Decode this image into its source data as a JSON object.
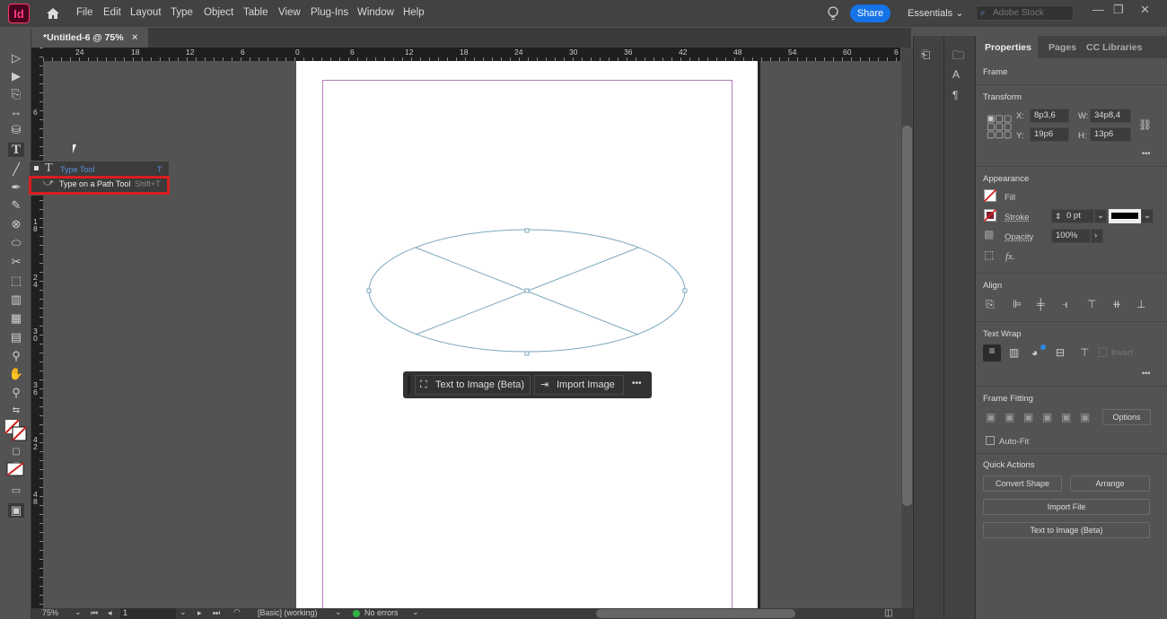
{
  "app": {
    "logo": "Id",
    "menu": [
      "File",
      "Edit",
      "Layout",
      "Type",
      "Object",
      "Table",
      "View",
      "Plug-Ins",
      "Window",
      "Help"
    ],
    "share_label": "Share",
    "workspace": "Essentials",
    "search_placeholder": "Adobe Stock",
    "accent": "#1473e6"
  },
  "document": {
    "tab_title": "*Untitled-6 @ 75%",
    "close_glyph": "×"
  },
  "rulers": {
    "horizontal": [
      "24",
      "18",
      "12",
      "6",
      "0",
      "6",
      "12",
      "18",
      "24",
      "30",
      "36",
      "42",
      "48",
      "54",
      "60",
      "6"
    ],
    "vertical": [
      "6",
      "1 8",
      "2 4",
      "3 0",
      "3 6",
      "4 2",
      "4 8"
    ]
  },
  "flyout": {
    "items": [
      {
        "label": "Type Tool",
        "shortcut": "T",
        "active": true
      },
      {
        "label": "Type on a Path Tool",
        "shortcut": "Shift+T",
        "highlighted": true
      }
    ],
    "highlight_color": "#d81e1e"
  },
  "context_bar": {
    "text_to_image": "Text to Image (Beta)",
    "import_image": "Import Image",
    "more": "•••"
  },
  "status": {
    "zoom": "75%",
    "page": "1",
    "preflight_profile": "[Basic] (working)",
    "errors": "No errors",
    "ok_color": "#2fb344"
  },
  "properties": {
    "tabs": [
      "Properties",
      "Pages",
      "CC Libraries"
    ],
    "object_type": "Frame",
    "transform": {
      "title": "Transform",
      "x_label": "X:",
      "x": "8p3,6",
      "y_label": "Y:",
      "y": "19p6",
      "w_label": "W:",
      "w": "34p8,4",
      "h_label": "H:",
      "h": "13p6"
    },
    "appearance": {
      "title": "Appearance",
      "fill": "Fill",
      "stroke": "Stroke",
      "stroke_weight": "0 pt",
      "opacity_label": "Opacity",
      "opacity": "100%",
      "fx": "fx."
    },
    "align_title": "Align",
    "text_wrap": {
      "title": "Text Wrap",
      "invert": "Invert"
    },
    "frame_fitting": {
      "title": "Frame Fitting",
      "options": "Options",
      "auto_fit": "Auto-Fit"
    },
    "quick_actions": {
      "title": "Quick Actions",
      "convert_shape": "Convert Shape",
      "arrange": "Arrange",
      "import_file": "Import File",
      "text_to_image": "Text to Image (Beta)"
    },
    "more": "•••"
  }
}
